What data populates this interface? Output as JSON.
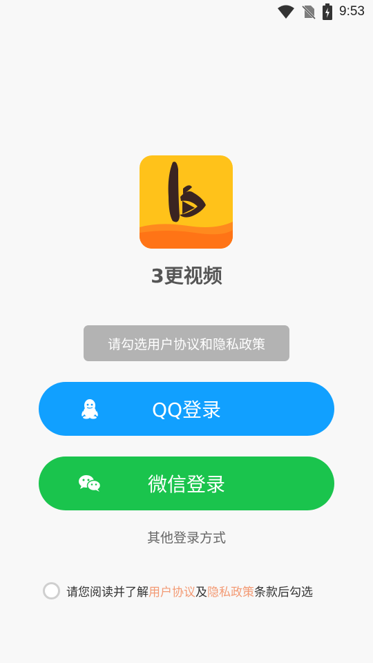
{
  "status_bar": {
    "time": "9:53",
    "icons": [
      "wifi-icon",
      "no-sim-icon",
      "battery-charging-icon"
    ]
  },
  "app": {
    "name": "3更视频",
    "logo_icon": "app-logo-icon"
  },
  "toast": {
    "text": "请勾选用户协议和隐私政策"
  },
  "buttons": {
    "qq_label": "QQ登录",
    "qq_icon": "qq-penguin-icon",
    "wechat_label": "微信登录",
    "wechat_icon": "wechat-icon"
  },
  "other_login": "其他登录方式",
  "agreement": {
    "prefix": "请您阅读并了解",
    "user_agreement": "用户协议",
    "conjunction": "及",
    "privacy_policy": "隐私政策",
    "suffix": "条款后勾选",
    "checked": false
  },
  "colors": {
    "qq_button": "#11a0ff",
    "wechat_button": "#1ac44d",
    "toast_bg": "#b3b3b3",
    "link": "#f39a74",
    "logo_yellow": "#ffc21a",
    "logo_orange": "#ff7a1a"
  }
}
